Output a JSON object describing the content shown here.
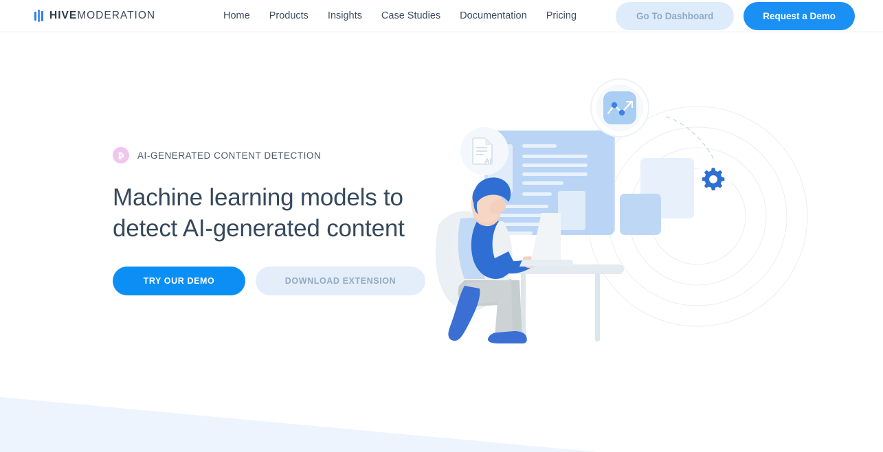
{
  "header": {
    "logo": {
      "icon": "hive-bars-logo",
      "primary": "HIVE",
      "secondary": "MODERATION"
    },
    "nav": [
      {
        "label": "Home"
      },
      {
        "label": "Products"
      },
      {
        "label": "Insights"
      },
      {
        "label": "Case Studies"
      },
      {
        "label": "Documentation"
      },
      {
        "label": "Pricing"
      }
    ],
    "dashboard_button": "Go To Dashboard",
    "demo_button": "Request a Demo"
  },
  "hero": {
    "eyebrow_icon": "document-ai-icon",
    "eyebrow": "AI-GENERATED CONTENT DETECTION",
    "headline_line1": "Machine learning models to",
    "headline_line2": "detect AI-generated content",
    "primary_cta": "TRY OUR DEMO",
    "secondary_cta": "DOWNLOAD EXTENSION"
  },
  "illustration": {
    "alt": "person at desk with laptop reviewing an AI generated document",
    "badges": [
      {
        "name": "document-ai-badge",
        "icon": "document-ai-icon"
      },
      {
        "name": "analytics-badge",
        "icon": "line-chart-icon"
      },
      {
        "name": "settings-badge",
        "icon": "gear-icon"
      }
    ]
  },
  "colors": {
    "accent_blue": "#1b90f4",
    "deep_blue": "#2f6fd4",
    "soft_blue": "#b9d4f5",
    "pale_blue": "#dce9fa",
    "text_dark": "#36495c",
    "text_nav": "#3d4d60",
    "muted_blue": "#93a9c3",
    "badge_pink": "#efc6ee",
    "wedge_blue": "#eef4fd"
  }
}
